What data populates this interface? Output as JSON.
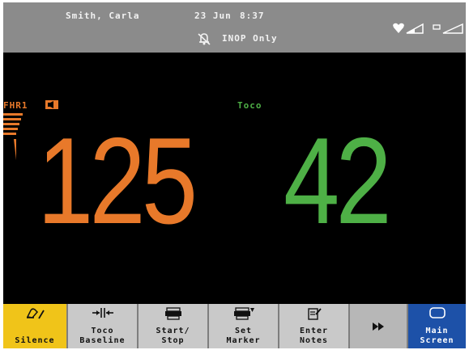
{
  "colors": {
    "fhr": "#e8792a",
    "toco": "#4eb046",
    "header_bg": "#8b8b8b",
    "silence_bg": "#f0c419",
    "main_screen_bg": "#1d51a8"
  },
  "header": {
    "patient_name": "Smith, Carla",
    "date": "23 Jun",
    "time": "8:37",
    "alarm_status": "INOP Only",
    "icons": [
      "alarm-off-icon",
      "heartbeat-signal-icon",
      "battery-signal-icon"
    ]
  },
  "numerics": {
    "fhr": {
      "label": "FHR1",
      "value": "125",
      "icon": "speaker-icon"
    },
    "toco": {
      "label": "Toco",
      "value": "42"
    }
  },
  "smartkeys": {
    "silence": {
      "line1": "Silence",
      "icon": "silence-icon"
    },
    "toco_baseline": {
      "line1": "Toco",
      "line2": "Baseline",
      "icon": "baseline-icon"
    },
    "start_stop": {
      "line1": "Start/",
      "line2": "Stop",
      "icon": "printer-icon"
    },
    "set_marker": {
      "line1": "Set",
      "line2": "Marker",
      "icon": "marker-printer-icon"
    },
    "enter_notes": {
      "line1": "Enter",
      "line2": "Notes",
      "icon": "notes-icon"
    },
    "more": {
      "icon": "fast-forward-icon"
    },
    "main_screen": {
      "line1": "Main",
      "line2": "Screen",
      "icon": "main-screen-icon"
    }
  }
}
